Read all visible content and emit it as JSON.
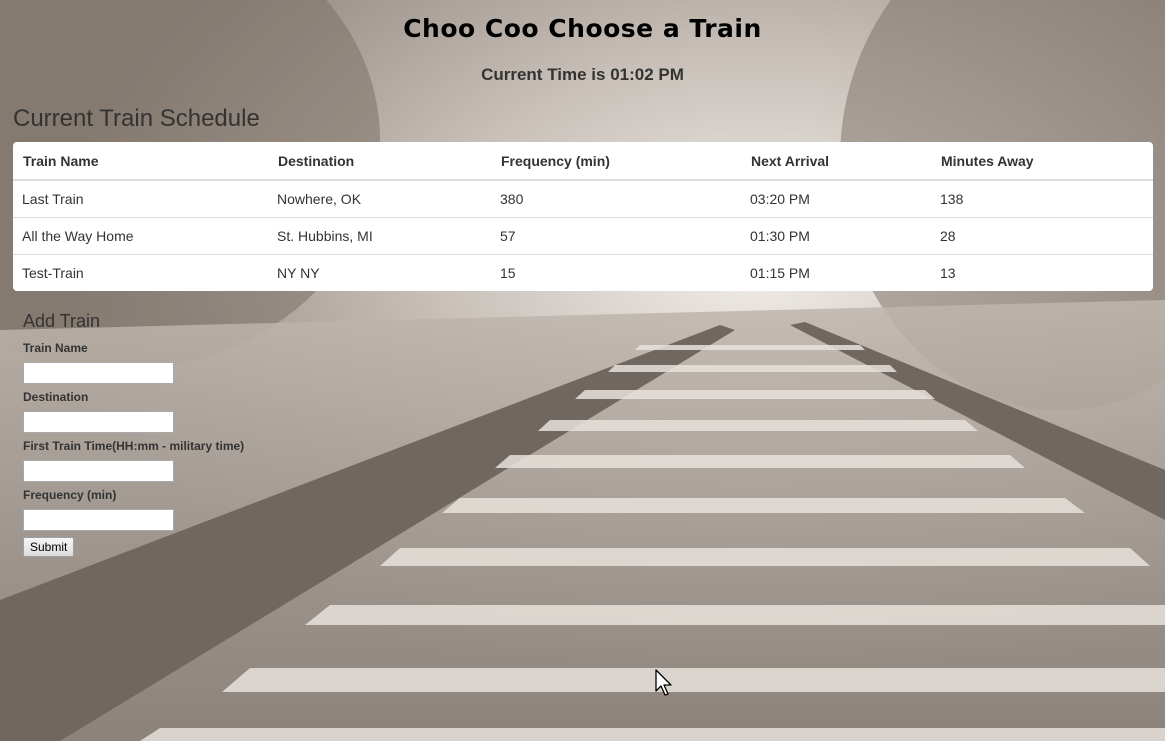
{
  "header": {
    "title": "Choo Coo Choose a Train",
    "current_time_prefix": "Current Time is ",
    "current_time_value": "01:02 PM"
  },
  "schedule": {
    "heading": "Current Train Schedule",
    "columns": [
      "Train Name",
      "Destination",
      "Frequency (min)",
      "Next Arrival",
      "Minutes Away"
    ],
    "rows": [
      [
        "Last Train",
        "Nowhere, OK",
        "380",
        "03:20 PM",
        "138"
      ],
      [
        "All the Way Home",
        "St. Hubbins, MI",
        "57",
        "01:30 PM",
        "28"
      ],
      [
        "Test-Train",
        "NY NY",
        "15",
        "01:15 PM",
        "13"
      ]
    ]
  },
  "add_train": {
    "heading": "Add Train",
    "fields": [
      {
        "label": "Train Name",
        "value": ""
      },
      {
        "label": "Destination",
        "value": ""
      },
      {
        "label": "First Train Time(HH:mm - military time)",
        "value": ""
      },
      {
        "label": "Frequency (min)",
        "value": ""
      }
    ],
    "submit_label": "Submit"
  },
  "icons": {
    "cursor": "mouse-pointer-icon"
  }
}
